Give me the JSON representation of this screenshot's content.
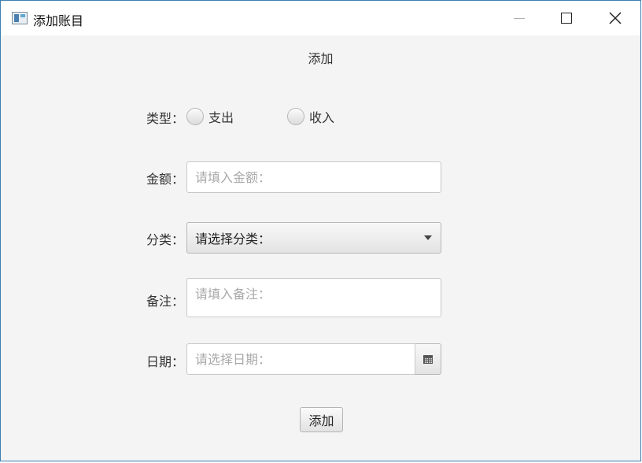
{
  "window": {
    "title": "添加账目"
  },
  "form": {
    "heading": "添加",
    "type": {
      "label": "类型：",
      "options": [
        "支出",
        "收入"
      ]
    },
    "amount": {
      "label": "金额：",
      "placeholder": "请填入金额：",
      "value": ""
    },
    "category": {
      "label": "分类：",
      "selected": "请选择分类："
    },
    "note": {
      "label": "备注：",
      "placeholder": "请填入备注：",
      "value": ""
    },
    "date": {
      "label": "日期：",
      "placeholder": "请选择日期：",
      "value": ""
    },
    "submit_label": "添加"
  },
  "icons": {
    "app": "app-window-icon",
    "minimize": "minimize-icon",
    "maximize": "maximize-icon",
    "close": "close-icon",
    "dropdown": "chevron-down-icon",
    "calendar": "calendar-icon"
  },
  "colors": {
    "window_border": "#3c7fb1",
    "background": "#f4f4f4"
  }
}
